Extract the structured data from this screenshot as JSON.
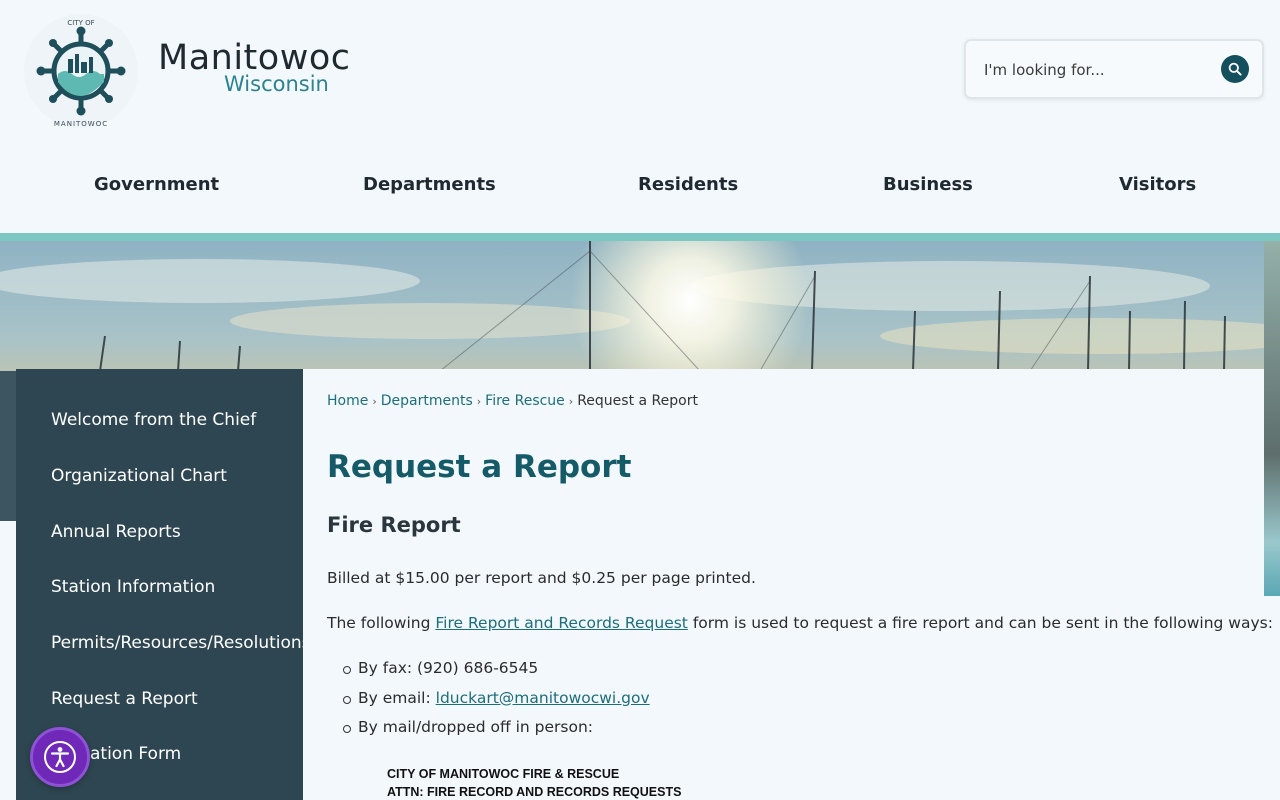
{
  "header": {
    "seal_text_top": "CITY OF",
    "seal_text_bottom": "MANITOWOC",
    "brand_main": "Manitowoc",
    "brand_sub": "Wisconsin",
    "search": {
      "placeholder": "I'm looking for...",
      "icon": "search-icon"
    }
  },
  "nav": {
    "items": [
      "Government",
      "Departments",
      "Residents",
      "Business",
      "Visitors"
    ]
  },
  "sidebar": {
    "items": [
      "Welcome from the Chief",
      "Organizational Chart",
      "Annual Reports",
      "Station Information",
      "Permits/Resources/Resolutions",
      "Request a Report",
      "ation Form"
    ]
  },
  "breadcrumb": {
    "home": "Home",
    "departments": "Departments",
    "fire_rescue": "Fire Rescue",
    "current": "Request a Report",
    "separator": "›"
  },
  "main": {
    "title": "Request a Report",
    "subhead": "Fire Report",
    "billing": "Billed at $15.00 per report and $0.25 per page printed.",
    "intro_before": "The following ",
    "intro_link": "Fire Report and Records Request",
    "intro_after": " form is used to request a fire report and can be sent in the following ways:",
    "bullet_fax": "By fax: (920) 686-6545",
    "bullet_email_label": "By email: ",
    "bullet_email_link": "lduckart@manitowocwi.gov",
    "bullet_mail": "By mail/dropped off in person:",
    "address_line1": "CITY OF MANITOWOC FIRE & RESCUE",
    "address_line2": "ATTN: FIRE RECORD AND RECORDS REQUESTS"
  },
  "colors": {
    "brand_teal": "#155a67",
    "accent_bar": "#7cc7c1",
    "sidebar_bg": "#2e4651",
    "link": "#1d6e7d",
    "a11y_purple": "#6f28b8"
  },
  "accessibility": {
    "icon": "accessibility-icon"
  }
}
